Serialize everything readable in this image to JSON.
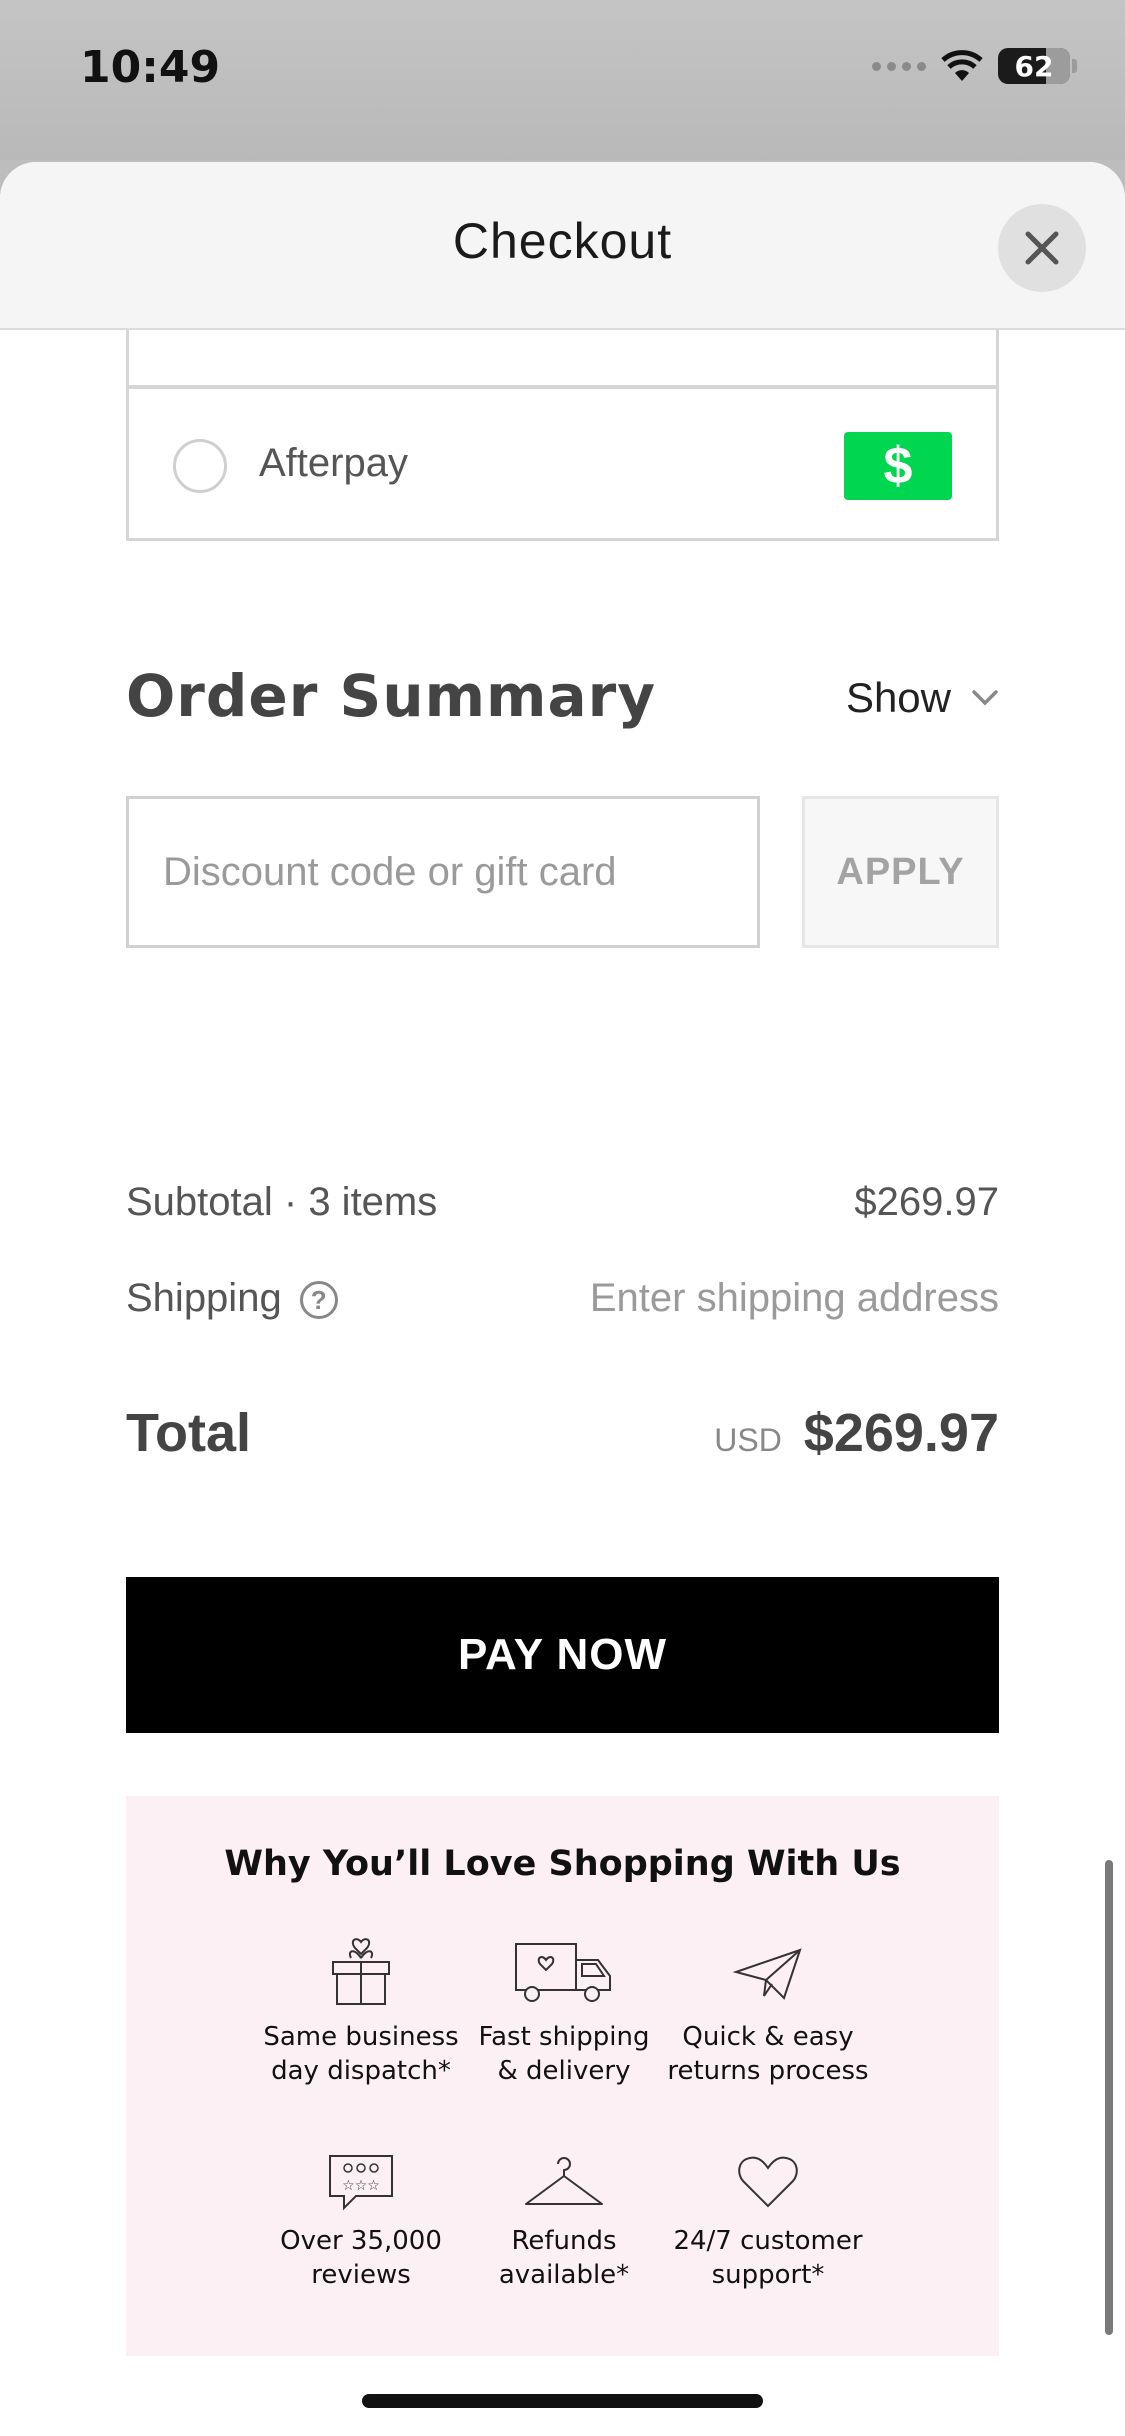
{
  "status_bar": {
    "time": "10:49",
    "battery": "62"
  },
  "header": {
    "title": "Checkout"
  },
  "payment": {
    "option_label": "Afterpay",
    "badge": "$"
  },
  "summary": {
    "title": "Order Summary",
    "toggle_label": "Show",
    "discount_placeholder": "Discount code or gift card",
    "apply_label": "APPLY",
    "subtotal_label": "Subtotal · 3 items",
    "subtotal_value": "$269.97",
    "shipping_label": "Shipping",
    "shipping_value": "Enter shipping address",
    "total_label": "Total",
    "currency": "USD",
    "total_value": "$269.97"
  },
  "pay_button": {
    "label": "PAY NOW"
  },
  "why": {
    "title": "Why You’ll Love Shopping With Us",
    "features": [
      {
        "line1": "Same business",
        "line2": "day dispatch*",
        "icon": "gift-box-icon"
      },
      {
        "line1": "Fast shipping",
        "line2": "& delivery",
        "icon": "delivery-truck-icon"
      },
      {
        "line1": "Quick & easy",
        "line2": "returns process",
        "icon": "paper-plane-icon"
      },
      {
        "line1": "Over 35,000",
        "line2": "reviews",
        "icon": "review-bubble-icon"
      },
      {
        "line1": "Refunds",
        "line2": "available*",
        "icon": "hanger-icon"
      },
      {
        "line1": "24/7 customer",
        "line2": "support*",
        "icon": "heart-icon"
      }
    ]
  },
  "colors": {
    "accent_green": "#00d64f",
    "pink_bg": "#fdf0f5",
    "button_black": "#000000"
  }
}
